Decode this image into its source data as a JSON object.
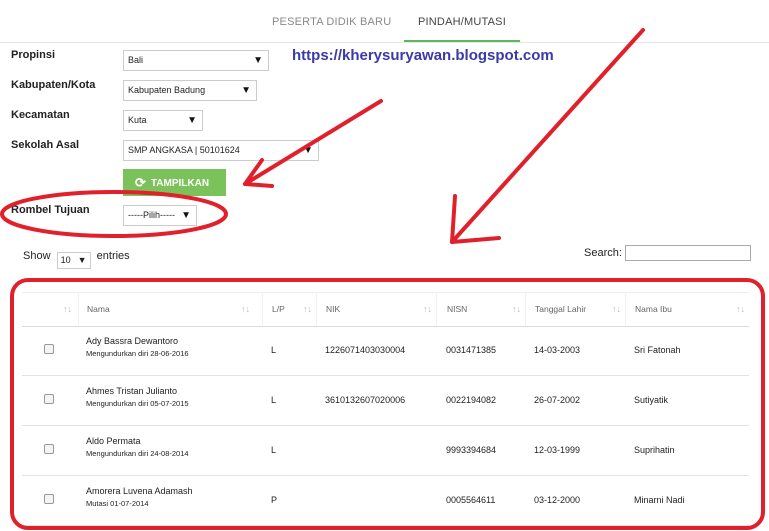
{
  "tabs": [
    {
      "label": "PESERTA DIDIK BARU"
    },
    {
      "label": "PINDAH/MUTASI"
    }
  ],
  "watermark_url": "https://kherysuryawan.blogspot.com",
  "form": {
    "propinsi": {
      "label": "Propinsi",
      "value": "Bali"
    },
    "kabupaten": {
      "label": "Kabupaten/Kota",
      "value": "Kabupaten Badung"
    },
    "kecamatan": {
      "label": "Kecamatan",
      "value": "Kuta"
    },
    "sekolah": {
      "label": "Sekolah Asal",
      "value": "SMP ANGKASA | 50101624"
    },
    "tampilkan_label": "TAMPILKAN",
    "rombel": {
      "label": "Rombel Tujuan",
      "value": "-----Pilih-----"
    }
  },
  "table_controls": {
    "show_label": "Show",
    "entries_value": "10",
    "entries_label": "entries",
    "search_label": "Search:"
  },
  "table": {
    "headers": [
      "",
      "Nama",
      "L/P",
      "NIK",
      "NISN",
      "Tanggal Lahir",
      "Nama Ibu"
    ],
    "rows": [
      {
        "nama": "Ady Bassra Dewantoro",
        "status": "Mengundurkan diri 28-06-2016",
        "lp": "L",
        "nik": "1226071403030004",
        "nisn": "0031471385",
        "tgl": "14-03-2003",
        "ibu": "Sri Fatonah"
      },
      {
        "nama": "Ahmes Tristan Julianto",
        "status": "Mengundurkan diri 05-07-2015",
        "lp": "L",
        "nik": "3610132607020006",
        "nisn": "0022194082",
        "tgl": "26-07-2002",
        "ibu": "Sutiyatik"
      },
      {
        "nama": "Aldo Permata",
        "status": "Mengundurkan diri 24-08-2014",
        "lp": "L",
        "nik": "",
        "nisn": "9993394684",
        "tgl": "12-03-1999",
        "ibu": "Suprihatin"
      },
      {
        "nama": "Amorera Luvena Adamash",
        "status": "Mutasi 01-07-2014",
        "lp": "P",
        "nik": "",
        "nisn": "0005564611",
        "tgl": "03-12-2000",
        "ibu": "Minarni Nadi"
      }
    ]
  },
  "colors": {
    "accent_green": "#7cc25a",
    "annotation_red": "#e0202a",
    "url_blue": "#3a3aa8"
  },
  "icons": [
    "refresh-icon",
    "sort-icon",
    "caret-down-icon"
  ]
}
